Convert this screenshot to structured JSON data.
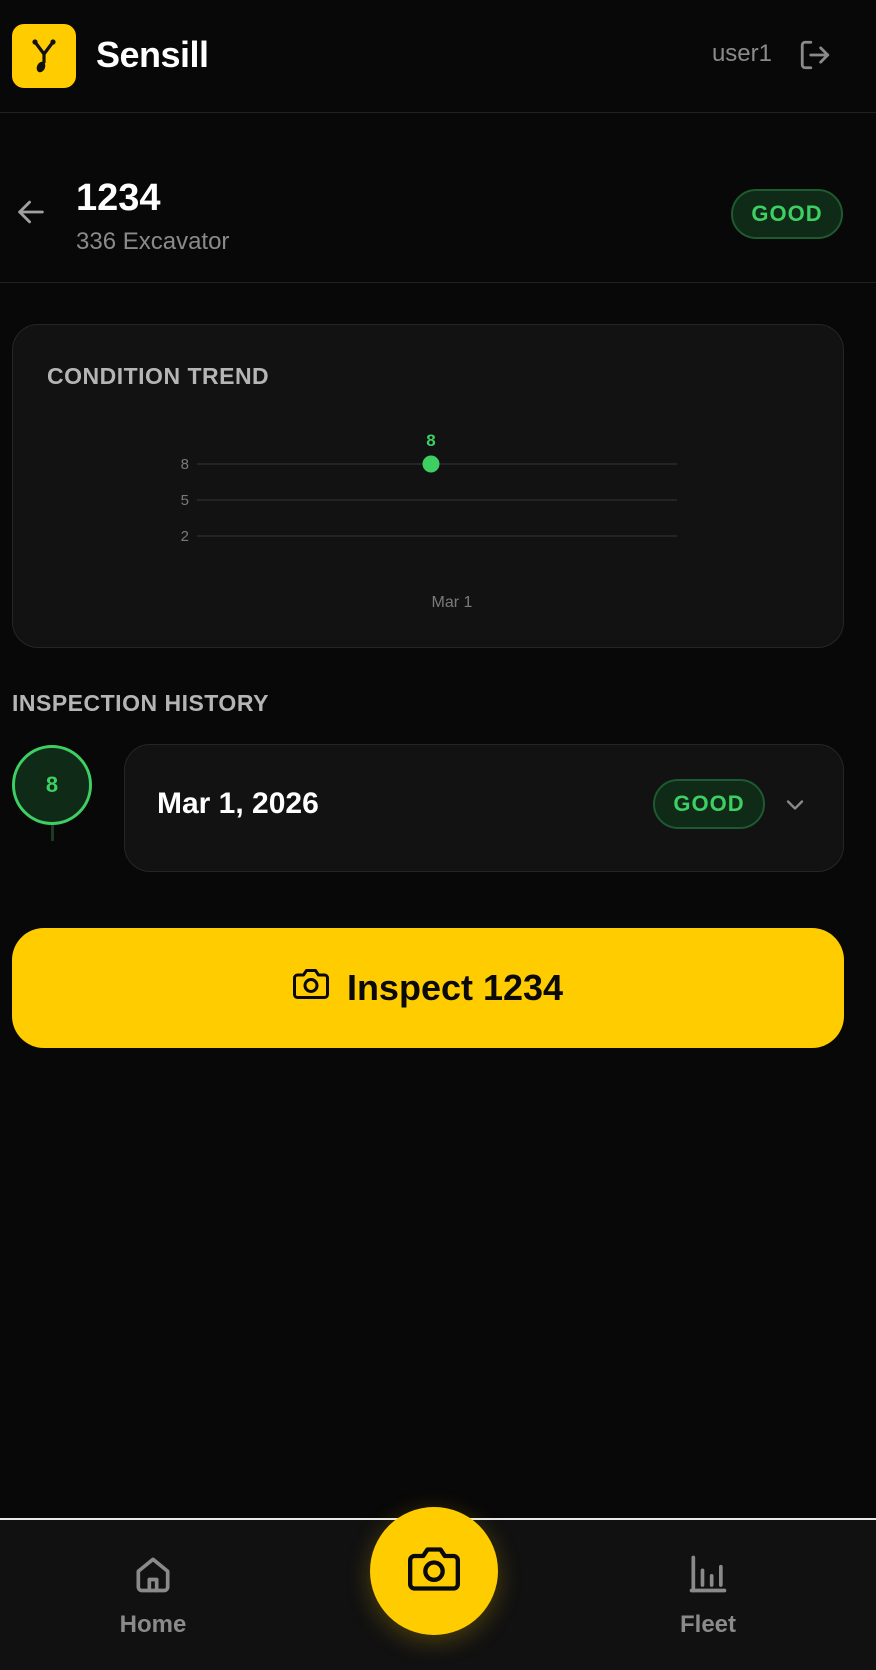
{
  "header": {
    "brand": "Sensill",
    "username": "user1",
    "logo_icon": "sensor-logo-icon",
    "logout_icon": "logout-icon"
  },
  "asset": {
    "id": "1234",
    "model": "336 Excavator",
    "status": "GOOD",
    "status_color": "#3ecf63"
  },
  "trend": {
    "title": "CONDITION TREND",
    "chart_data": {
      "type": "line",
      "title": "CONDITION TREND",
      "xlabel": "",
      "ylabel": "",
      "categories": [
        "Mar 1"
      ],
      "series": [
        {
          "values": [
            8
          ]
        }
      ],
      "y_ticks": [
        8,
        5,
        2
      ],
      "ylim": [
        0,
        10
      ],
      "grid": true,
      "data_labels": true,
      "color": "#3ecf63"
    }
  },
  "history": {
    "title": "INSPECTION HISTORY",
    "items": [
      {
        "score": "8",
        "date": "Mar 1, 2026",
        "status": "GOOD"
      }
    ]
  },
  "inspect_button": {
    "label": "Inspect 1234",
    "icon": "camera-icon"
  },
  "bottom_nav": {
    "items": [
      {
        "label": "Home",
        "icon": "home-icon"
      },
      {
        "label": "",
        "icon": "camera-icon"
      },
      {
        "label": "Fleet",
        "icon": "bar-chart-icon"
      }
    ]
  },
  "colors": {
    "accent": "#ffcc00",
    "background": "#080808",
    "good": "#3ecf63"
  }
}
